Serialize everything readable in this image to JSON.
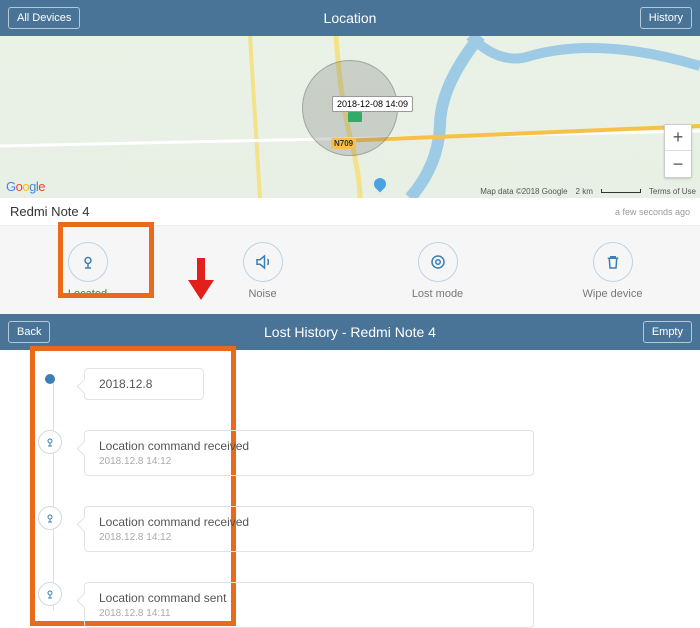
{
  "header": {
    "left_button": "All Devices",
    "title": "Location",
    "right_button": "History"
  },
  "map": {
    "pin_label": "2018-12-08 14:09",
    "highway": "N709",
    "attribution": "Map data ©2018 Google",
    "scale": "2 km",
    "terms": "Terms of Use",
    "logo": "Google",
    "zoom_in": "+",
    "zoom_out": "−"
  },
  "device_bar": {
    "name": "Redmi Note 4",
    "ago": "a few seconds ago"
  },
  "actions": {
    "located": "Located",
    "noise": "Noise",
    "lost": "Lost mode",
    "wipe": "Wipe device"
  },
  "subheader": {
    "back": "Back",
    "title": "Lost History - Redmi Note 4",
    "empty": "Empty"
  },
  "history": [
    {
      "title": "2018.12.8",
      "sub": ""
    },
    {
      "title": "Location command received",
      "sub": "2018.12.8 14:12"
    },
    {
      "title": "Location command received",
      "sub": "2018.12.8 14:12"
    },
    {
      "title": "Location command sent",
      "sub": "2018.12.8 14:11"
    }
  ]
}
